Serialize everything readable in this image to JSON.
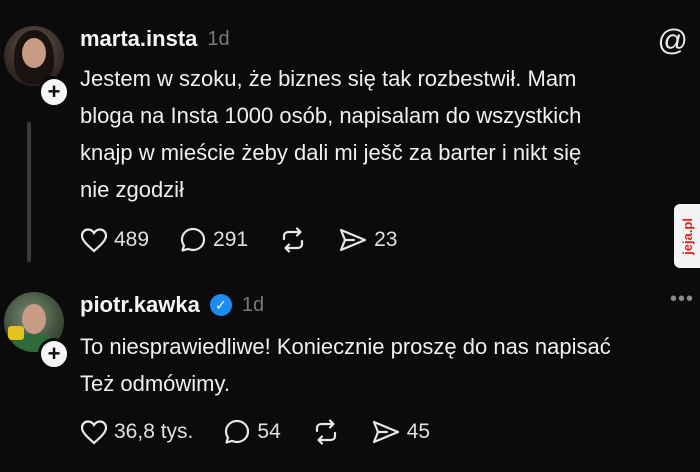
{
  "posts": [
    {
      "username": "marta.insta",
      "time": "1d",
      "text_lines": [
        "Jestem w szoku, że biznes się tak rozbestwił. Mam",
        "bloga na Insta 1000 osób, napisalam do wszystkich",
        "knajp w mieście żeby dali mi ješč za barter i nikt się",
        "nie zgodził"
      ],
      "likes": "489",
      "comments": "291",
      "shares": "23",
      "corner_icon": "at-icon"
    },
    {
      "username": "piotr.kawka",
      "time": "1d",
      "verified": true,
      "text_lines": [
        "To niesprawiedliwe! Koniecznie proszę do nas napisać",
        "Też odmówimy."
      ],
      "likes": "36,8 tys.",
      "comments": "54",
      "shares": "45",
      "corner_icon": "more-icon"
    }
  ],
  "watermark": "jeja.pl",
  "colors": {
    "background": "#0b0b0b",
    "verified": "#1d8cf0",
    "watermark_text": "#e2231a"
  }
}
